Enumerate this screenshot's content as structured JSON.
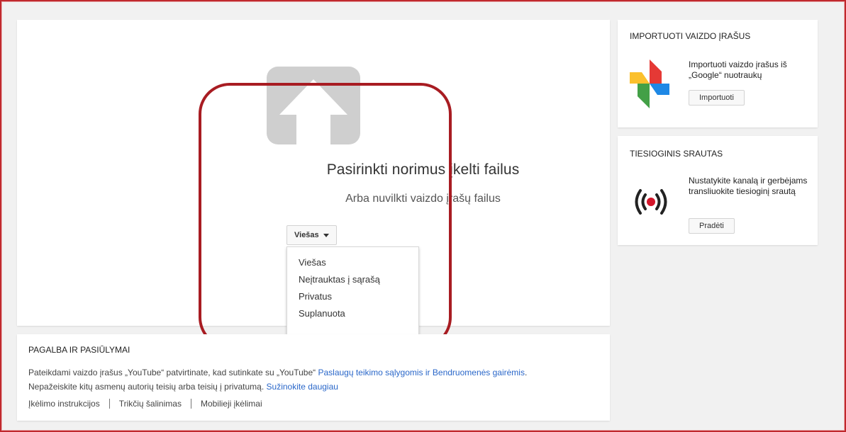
{
  "upload": {
    "title": "Pasirinkti norimus įkelti failus",
    "subtitle": "Arba nuvilkti vaizdo įrašų failus",
    "privacy_selected": "Viešas",
    "privacy_options": [
      "Viešas",
      "Neįtrauktas į sąrašą",
      "Privatus",
      "Suplanuota"
    ]
  },
  "help": {
    "title": "PAGALBA IR PASIŪLYMAI",
    "line1_prefix": "Pateikdami vaizdo įrašus „YouTube“ patvirtinate, kad sutinkate su „YouTube“",
    "terms_link": "Paslaugų teikimo sąlygomis",
    "and": "ir",
    "guidelines_link": "Bendruomenės gairėmis",
    "line2_prefix": "Nepažeiskite kitų asmenų autorių teisių arba teisių į privatumą.",
    "learn_more": "Sužinokite daugiau",
    "links": [
      "Įkėlimo instrukcijos",
      "Trikčių šalinimas",
      "Mobilieji įkėlimai"
    ]
  },
  "import": {
    "title": "IMPORTUOTI VAIZDO ĮRAŠUS",
    "text": "Importuoti vaizdo įrašus iš „Google“ nuotraukų",
    "button": "Importuoti"
  },
  "live": {
    "title": "TIESIOGINIS SRAUTAS",
    "text": "Nustatykite kanalą ir gerbėjams transliuokite tiesioginį srautą",
    "button": "Pradėti"
  },
  "icons": {
    "upload": "upload-arrow-icon",
    "photos": "google-photos-pinwheel-icon",
    "live": "live-broadcast-icon",
    "caret": "caret-down-icon"
  },
  "colors": {
    "accent_red": "#a81c22",
    "link_blue": "#2a67c9",
    "live_dot": "#d3152a"
  }
}
